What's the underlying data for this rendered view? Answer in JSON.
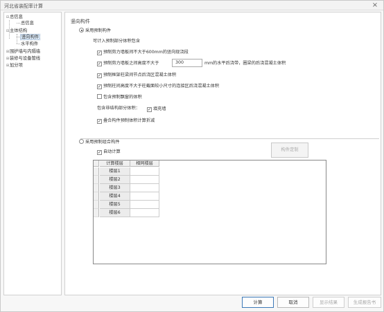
{
  "window": {
    "title": "河北省装配率计算"
  },
  "tree": {
    "items": [
      {
        "label": "总信息",
        "toggle": "⊟"
      },
      {
        "label": "总信息"
      },
      {
        "label": "主体结构",
        "toggle": "⊟"
      },
      {
        "label": "竖向构件"
      },
      {
        "label": "水平构件"
      },
      {
        "label": "围护墙与内隔墙",
        "toggle": "⊞"
      },
      {
        "label": "装修与设备管线",
        "toggle": "⊞"
      },
      {
        "label": "加分项",
        "toggle": "⊞"
      }
    ]
  },
  "panel": {
    "section_title": "竖向构件",
    "option_prefab": "采用预制构件",
    "included_intro": "可计入预制部分体积包含",
    "cb_wall_gap": "预制剪力墙板间不大于600mm的竖向现浇段",
    "cb_horizontal_pre": "预制剪力墙板之间高度不大于",
    "cb_horizontal_value": "300",
    "cb_horizontal_post": "mm的水平后浇带，圈梁的后浇混凝土体积",
    "cb_frame_joint": "预制框架柱梁间节点后浇区混凝土体积",
    "cb_column_joint": "预制柱间高度不大于柱截面较小尺寸的连接区后浇混凝土体积",
    "cb_bay_window": "包含预制飘窗的体积",
    "nonstruct_label": "包含非结构部分体积：",
    "cb_infill": "填充墙",
    "cb_deduct": "叠合构件预制体积计算折减",
    "option_combined": "采用预制组合构件",
    "cb_auto": "自动计算",
    "custom_button": "构件定制",
    "grid": {
      "headers": [
        "计算楼层",
        "相同楼层"
      ],
      "rows": [
        [
          "楼层1",
          ""
        ],
        [
          "楼层2",
          ""
        ],
        [
          "楼层3",
          ""
        ],
        [
          "楼层4",
          ""
        ],
        [
          "楼层5",
          ""
        ],
        [
          "楼层6",
          ""
        ]
      ]
    }
  },
  "buttons": {
    "calculate": "计算",
    "cancel": "取消",
    "show_result": "显示结果",
    "generate_report": "生成报告书"
  },
  "state": {
    "prefab_selected": true,
    "combined_selected": false,
    "checks": {
      "wall_gap": true,
      "horizontal": true,
      "frame_joint": true,
      "column_joint": true,
      "bay_window": false,
      "infill": true,
      "deduct": true,
      "auto": true
    }
  }
}
